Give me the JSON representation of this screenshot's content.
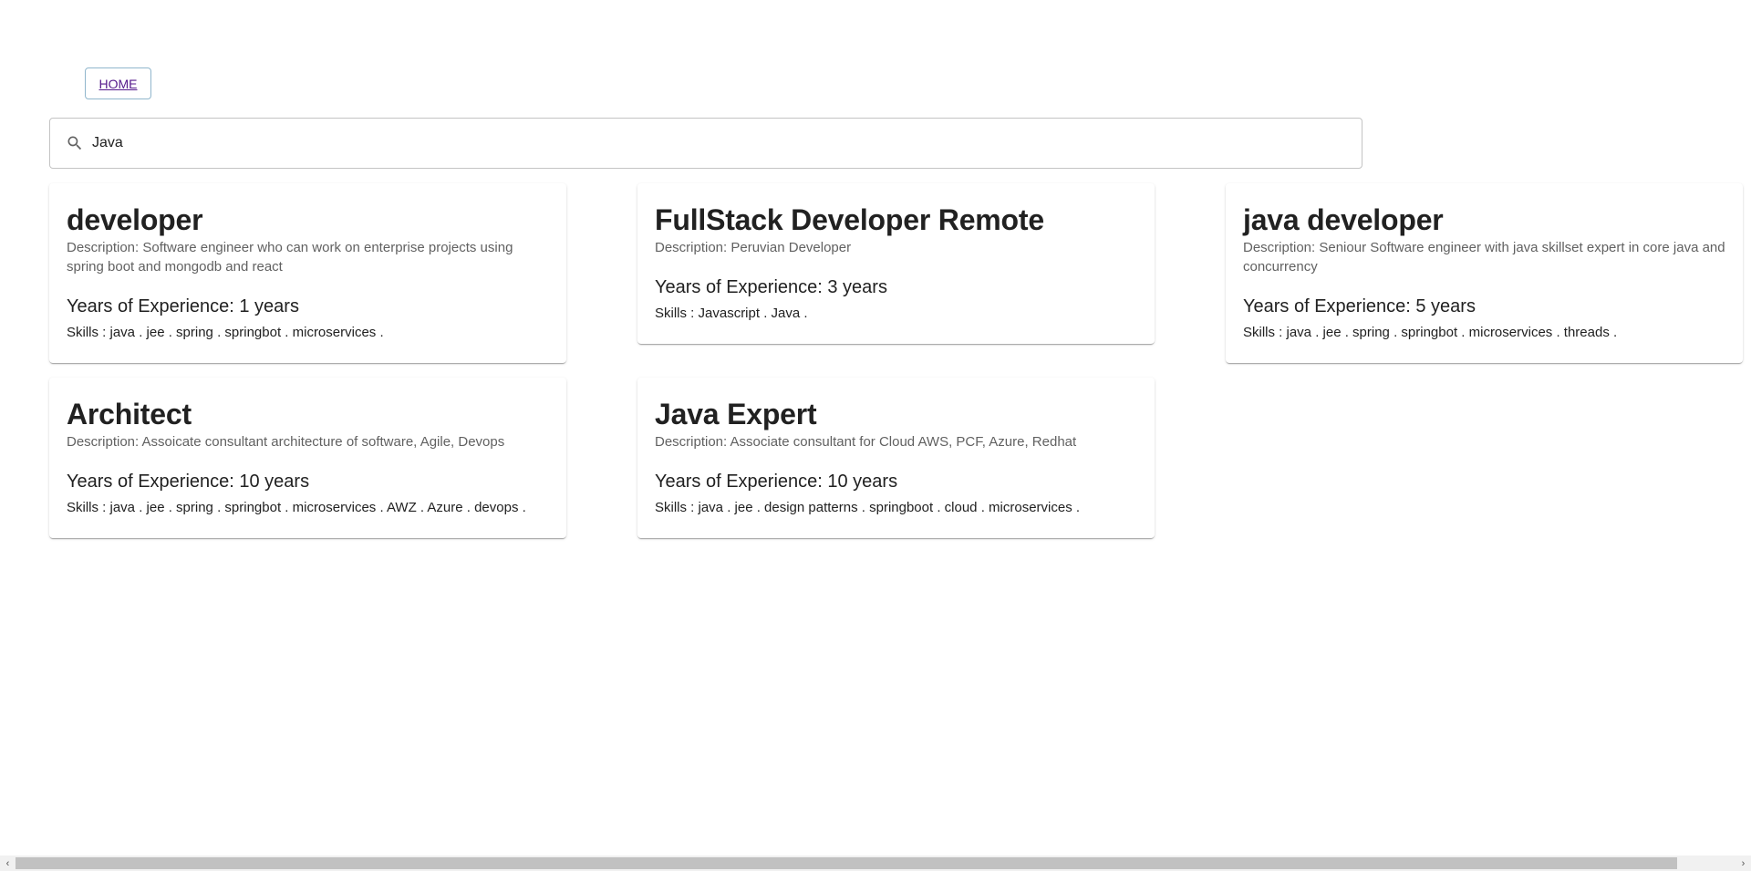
{
  "nav": {
    "home_label": "HOME"
  },
  "search": {
    "value": "Java",
    "icon": "search-icon"
  },
  "cards": [
    {
      "title": "developer",
      "description": "Description: Software engineer who can work on enterprise projects using spring boot and mongodb and react",
      "experience": "Years of Experience: 1 years",
      "skills": "Skills : java . jee . spring . springbot . microservices ."
    },
    {
      "title": "FullStack Developer Remote",
      "description": "Description: Peruvian Developer",
      "experience": "Years of Experience: 3 years",
      "skills": "Skills : Javascript . Java ."
    },
    {
      "title": "java developer",
      "description": "Description: Seniour Software engineer with java skillset expert in core java and concurrency",
      "experience": "Years of Experience: 5 years",
      "skills": "Skills : java . jee . spring . springbot . microservices . threads ."
    },
    {
      "title": "Architect",
      "description": "Description: Assoicate consultant architecture of software, Agile, Devops",
      "experience": "Years of Experience: 10 years",
      "skills": "Skills : java . jee . spring . springbot . microservices . AWZ . Azure . devops ."
    },
    {
      "title": "Java Expert",
      "description": "Description: Associate consultant for Cloud AWS, PCF, Azure, Redhat",
      "experience": "Years of Experience: 10 years",
      "skills": "Skills : java . jee . design patterns . springboot . cloud . microservices ."
    }
  ],
  "scrollbar": {
    "left_arrow": "‹",
    "right_arrow": "›"
  }
}
